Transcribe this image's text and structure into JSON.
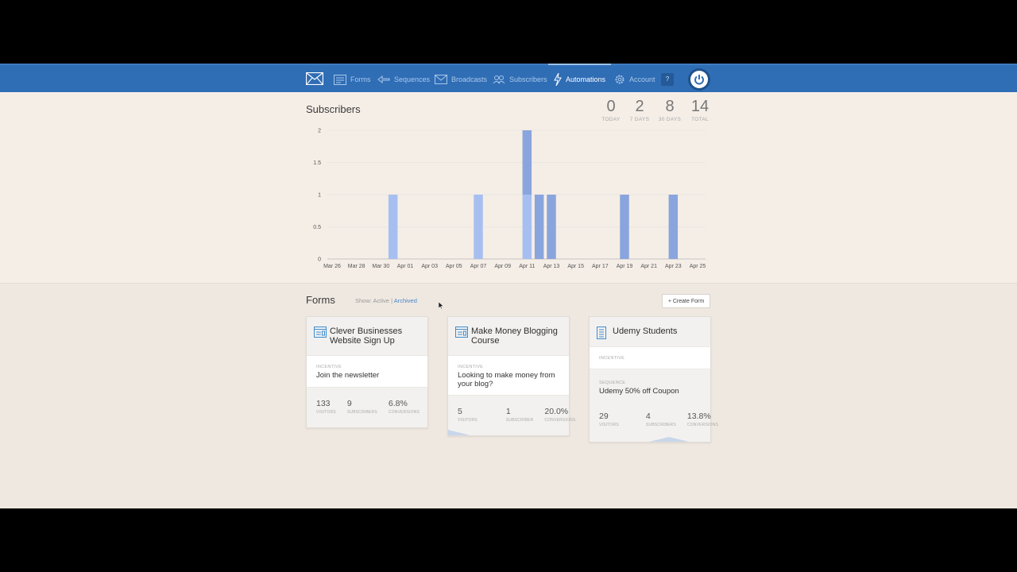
{
  "nav": {
    "items": [
      {
        "label": "Forms",
        "icon": "forms-icon"
      },
      {
        "label": "Sequences",
        "icon": "sequences-icon"
      },
      {
        "label": "Broadcasts",
        "icon": "broadcasts-icon"
      },
      {
        "label": "Subscribers",
        "icon": "subscribers-icon"
      },
      {
        "label": "Automations",
        "icon": "lightning-icon",
        "active": true
      },
      {
        "label": "Account",
        "icon": "gear-icon"
      }
    ],
    "help_label": "?",
    "colors": {
      "bar": "#2f6db5",
      "active_text": "#ffffff",
      "inactive_text": "#a9c8ea"
    }
  },
  "subscribers": {
    "title": "Subscribers",
    "stats": [
      {
        "value": "0",
        "label": "TODAY"
      },
      {
        "value": "2",
        "label": "7 DAYS"
      },
      {
        "value": "8",
        "label": "30 DAYS"
      },
      {
        "value": "14",
        "label": "TOTAL"
      }
    ]
  },
  "chart_data": {
    "type": "bar",
    "x_tick_labels": [
      "Mar 26",
      "Mar 28",
      "Mar 30",
      "Apr 01",
      "Apr 03",
      "Apr 05",
      "Apr 07",
      "Apr 09",
      "Apr 11",
      "Apr 13",
      "Apr 15",
      "Apr 17",
      "Apr 19",
      "Apr 21",
      "Apr 23",
      "Apr 25"
    ],
    "y_tick_labels": [
      "0",
      "0.5",
      "1",
      "1.5",
      "2"
    ],
    "ylim": [
      0,
      2
    ],
    "grid": true,
    "series": [
      {
        "color": "#a7bff0",
        "values": [
          {
            "x": "Mar 31",
            "y": 1
          },
          {
            "x": "Apr 07",
            "y": 1
          },
          {
            "x": "Apr 11",
            "y": 1
          }
        ]
      },
      {
        "color": "#8aa5dd",
        "values": [
          {
            "x": "Apr 11",
            "y": 1,
            "stack": true
          },
          {
            "x": "Apr 12",
            "y": 1
          },
          {
            "x": "Apr 13",
            "y": 1
          },
          {
            "x": "Apr 19",
            "y": 1
          },
          {
            "x": "Apr 23",
            "y": 1
          }
        ]
      }
    ]
  },
  "forms": {
    "title": "Forms",
    "show_label": "Show:",
    "active_label": "Active",
    "separator": "|",
    "archived_label": "Archived",
    "create_label": "+ Create Form",
    "cards": [
      {
        "title": "Clever Businesses Website Sign Up",
        "icon": "form-icon",
        "incentive_label": "INCENTIVE",
        "incentive": "Join the newsletter",
        "stats": [
          {
            "value": "133",
            "label": "VISITORS"
          },
          {
            "value": "9",
            "label": "SUBSCRIBERS"
          },
          {
            "value": "6.8%",
            "label": "CONVERSIONS"
          }
        ]
      },
      {
        "title": "Make Money Blogging Course",
        "icon": "form-icon",
        "incentive_label": "INCENTIVE",
        "incentive": "Looking to make money from your blog?",
        "stats": [
          {
            "value": "5",
            "label": "VISITORS"
          },
          {
            "value": "1",
            "label": "SUBSCRIBER"
          },
          {
            "value": "20.0%",
            "label": "CONVERSIONS"
          }
        ]
      },
      {
        "title": "Udemy Students",
        "icon": "landing-page-icon",
        "incentive_label": "INCENTIVE",
        "incentive": "",
        "sequence_label": "SEQUENCE",
        "sequence": "Udemy 50% off Coupon",
        "stats": [
          {
            "value": "29",
            "label": "VISITORS"
          },
          {
            "value": "4",
            "label": "SUBSCRIBERS"
          },
          {
            "value": "13.8%",
            "label": "CONVERSIONS"
          }
        ]
      }
    ]
  }
}
